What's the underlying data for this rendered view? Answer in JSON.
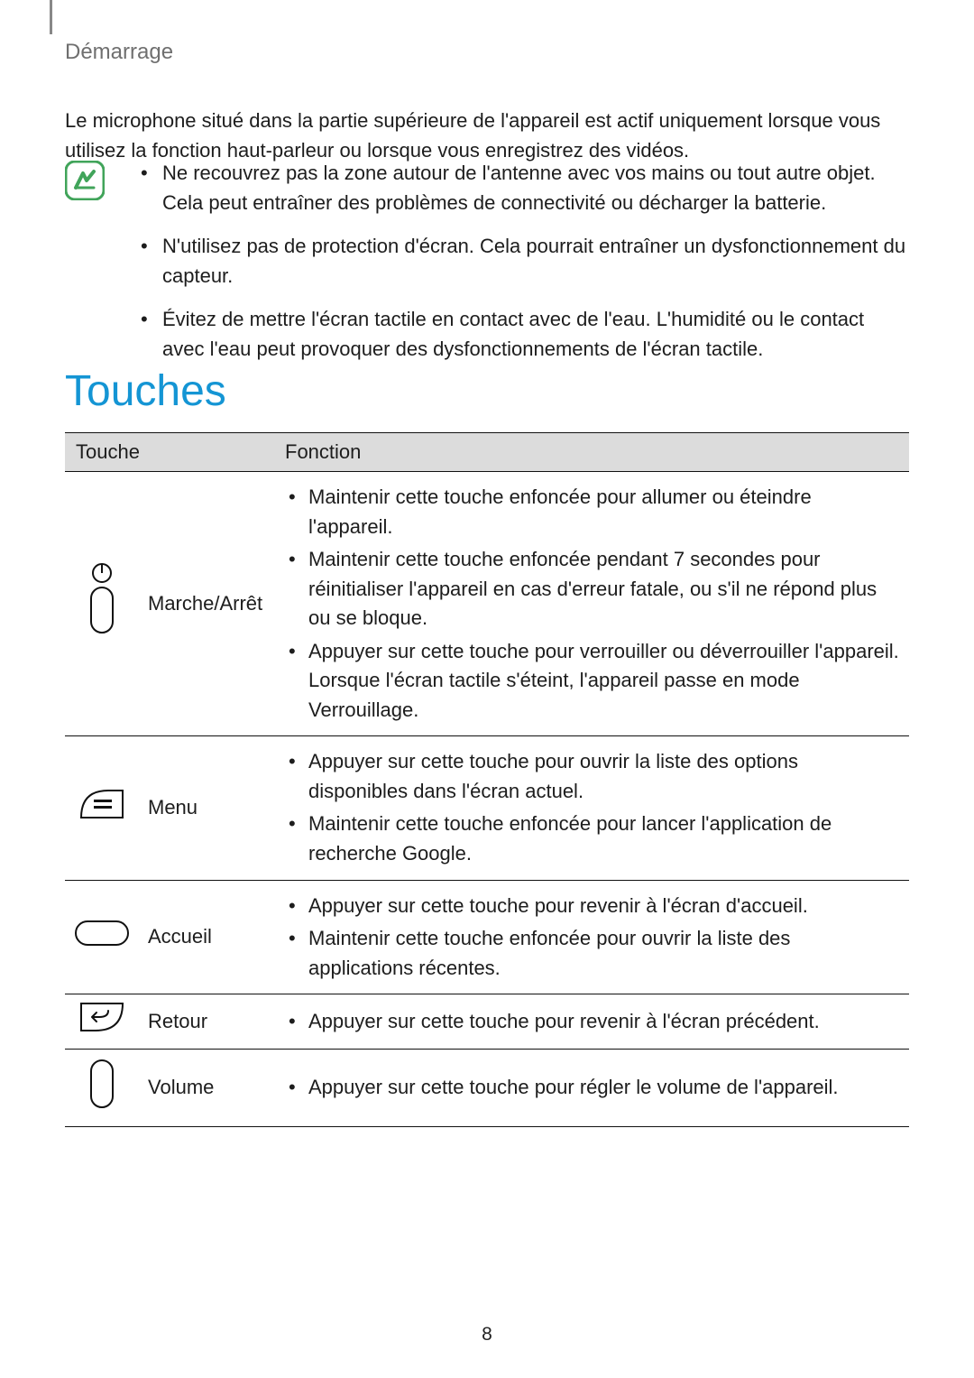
{
  "header": {
    "chapter": "Démarrage"
  },
  "intro_paragraph": "Le microphone situé dans la partie supérieure de l'appareil est actif uniquement lorsque vous utilisez la fonction haut-parleur ou lorsque vous enregistrez des vidéos.",
  "note": {
    "items": [
      "Ne recouvrez pas la zone autour de l'antenne avec vos mains ou tout autre objet. Cela peut entraîner des problèmes de connectivité ou décharger la batterie.",
      "N'utilisez pas de protection d'écran. Cela pourrait entraîner un dysfonctionnement du capteur.",
      "Évitez de mettre l'écran tactile en contact avec de l'eau. L'humidité ou le contact avec l'eau peut provoquer des dysfonctionnements de l'écran tactile."
    ]
  },
  "section_title": "Touches",
  "table": {
    "head": {
      "col1": "Touche",
      "col2": "Fonction"
    },
    "rows": [
      {
        "icon": "power-icon",
        "name": "Marche/Arrêt",
        "functions": [
          "Maintenir cette touche enfoncée pour allumer ou éteindre l'appareil.",
          "Maintenir cette touche enfoncée pendant 7 secondes pour réinitialiser l'appareil en cas d'erreur fatale, ou s'il ne répond plus ou se bloque.",
          "Appuyer sur cette touche pour verrouiller ou déverrouiller l'appareil. Lorsque l'écran tactile s'éteint, l'appareil passe en mode Verrouillage."
        ]
      },
      {
        "icon": "menu-icon",
        "name": "Menu",
        "functions": [
          "Appuyer sur cette touche pour ouvrir la liste des options disponibles dans l'écran actuel.",
          "Maintenir cette touche enfoncée pour lancer l'application de recherche Google."
        ]
      },
      {
        "icon": "home-icon",
        "name": "Accueil",
        "functions": [
          "Appuyer sur cette touche pour revenir à l'écran d'accueil.",
          "Maintenir cette touche enfoncée pour ouvrir la liste des applications récentes."
        ]
      },
      {
        "icon": "back-icon",
        "name": "Retour",
        "functions": [
          "Appuyer sur cette touche pour revenir à l'écran précédent."
        ]
      },
      {
        "icon": "volume-icon",
        "name": "Volume",
        "functions": [
          "Appuyer sur cette touche pour régler le volume de l'appareil."
        ]
      }
    ]
  },
  "page_number": "8"
}
